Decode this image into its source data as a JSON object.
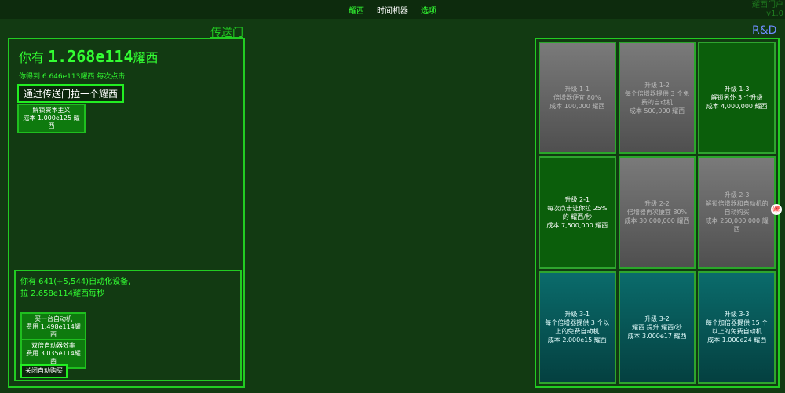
{
  "nav": {
    "tabs": [
      "耀西",
      "时间机器",
      "选项"
    ],
    "active": 1
  },
  "corner": {
    "title": "耀西门户",
    "version": "v1.0"
  },
  "portal": {
    "section_title": "传送门",
    "you_have_prefix": "你有",
    "amount": "1.268e114",
    "unit": "耀西",
    "per_click": "你得到 6.646e113耀西 每次点击",
    "main_button": "通过传送门拉一个耀西",
    "unlock_button": {
      "line1": "解锁资本主义",
      "line2": "成本 1.000e125 耀西"
    },
    "auto": {
      "line1": "你有 641(+5,544)自动化设备,",
      "line2": "拉 2.658e114耀西每秒",
      "buy_button": {
        "line1": "买一台自动机",
        "line2": "费用 1.498e114耀西"
      },
      "double_button": {
        "line1": "双倍自动器效率",
        "line2": "费用 3.035e114耀西"
      },
      "toggle_button": "关闭自动购买"
    }
  },
  "rd": {
    "section_title": "R&D",
    "upgrades": [
      {
        "title": "升级 1-1",
        "desc": "倍增器便宜 80%",
        "cost": "成本 100,000 耀西",
        "state": "locked"
      },
      {
        "title": "升级 1-2",
        "desc": "每个倍增器提供 3 个免费的自动机",
        "cost": "成本 500,000 耀西",
        "state": "locked"
      },
      {
        "title": "升级 1-3",
        "desc": "解锁另外 3 个升级",
        "cost": "成本 4,000,000 耀西",
        "state": "avail"
      },
      {
        "title": "升级 2-1",
        "desc": "每次点击让你拉 25% 的 耀西/秒",
        "cost": "成本 7,500,000 耀西",
        "state": "avail"
      },
      {
        "title": "升级 2-2",
        "desc": "倍增器再次便宜 80%",
        "cost": "成本 30,000,000 耀西",
        "state": "locked"
      },
      {
        "title": "升级 2-3",
        "desc": "解锁倍增器和自动机的自动购买",
        "cost": "成本 250,000,000 耀西",
        "state": "locked"
      },
      {
        "title": "升级 3-1",
        "desc": "每个倍增器提供 3 个以上的免费自动机",
        "cost": "成本 2.000e15 耀西",
        "state": "teal"
      },
      {
        "title": "升级 3-2",
        "desc": "耀西 提升 耀西/秒",
        "cost": "成本 3.000e17 耀西",
        "state": "teal"
      },
      {
        "title": "升级 3-3",
        "desc": "每个加倍器提供 15 个以上的免费自动机",
        "cost": "成本 1.000e24 耀西",
        "state": "teal"
      }
    ]
  },
  "side_icon": "github-icon"
}
